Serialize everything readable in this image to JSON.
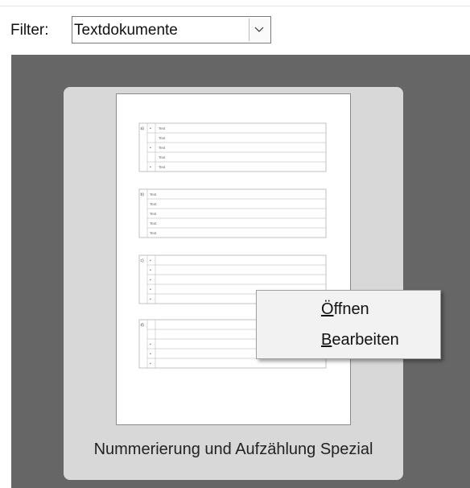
{
  "filter": {
    "label": "Filter:",
    "value": "Textdokumente"
  },
  "template": {
    "caption": "Nummerierung und Aufzählung Spezial",
    "thumbnail": {
      "sections": [
        {
          "marker": "a)",
          "rows": [
            {
              "bullet": "•",
              "text": "Text"
            },
            {
              "bullet": "",
              "text": "Text"
            },
            {
              "bullet": "•",
              "text": "Text"
            },
            {
              "bullet": "",
              "text": "Text"
            },
            {
              "bullet": "•",
              "text": "Text"
            }
          ]
        },
        {
          "marker": "b)",
          "rows": [
            {
              "text": "Text"
            },
            {
              "text": "Text"
            },
            {
              "text": "Text"
            },
            {
              "text": "Text"
            },
            {
              "text": "Text"
            }
          ]
        },
        {
          "marker": "c)",
          "rows": [
            {
              "bullet": "•"
            },
            {
              "bullet": "•"
            },
            {
              "bullet": "•"
            },
            {
              "bullet": "•"
            },
            {
              "bullet": "•"
            }
          ]
        },
        {
          "marker": "d)",
          "rows": [
            {
              "bullet": ""
            },
            {
              "bullet": ""
            },
            {
              "bullet": "•"
            },
            {
              "bullet": "•"
            },
            {
              "bullet": "•"
            }
          ]
        }
      ]
    }
  },
  "context_menu": {
    "items": [
      {
        "mnemonic": "",
        "underlined": "Ö",
        "rest": "ffnen",
        "full": "Öffnen"
      },
      {
        "mnemonic": "",
        "underlined": "B",
        "rest": "earbeiten",
        "full": "Bearbeiten"
      }
    ]
  }
}
